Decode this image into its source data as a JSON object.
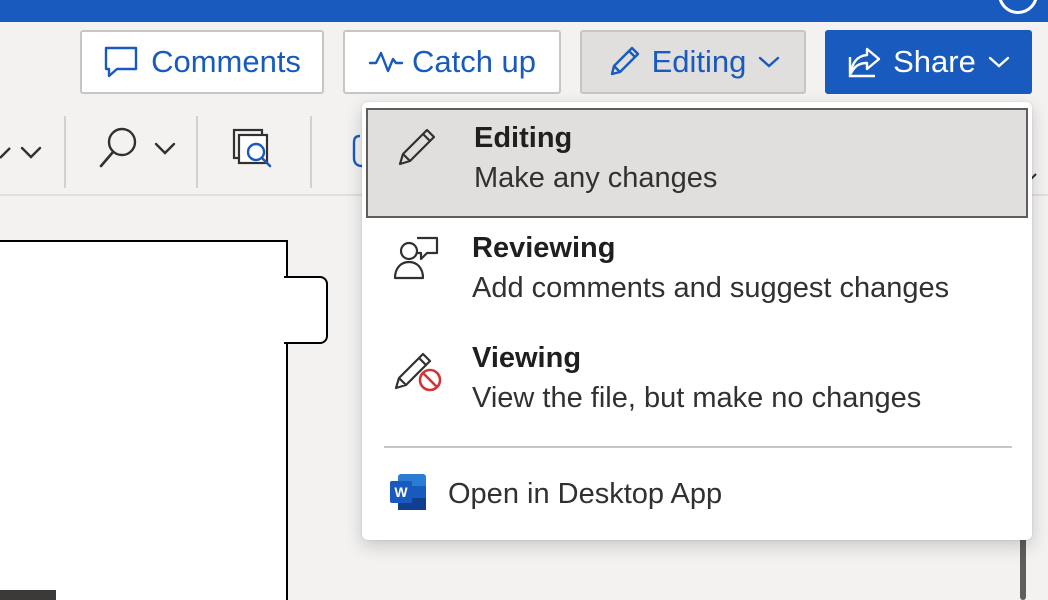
{
  "colors": {
    "brand": "#185abd",
    "selected_bg": "#e1dfdd",
    "text": "#201f1e"
  },
  "toolbar": {
    "comments_label": "Comments",
    "catchup_label": "Catch up",
    "editing_label": "Editing",
    "share_label": "Share"
  },
  "ribbon": {
    "icons": [
      "highlighter-dropdown-icon",
      "find-icon",
      "editor-search-icon",
      "dictate-icon"
    ]
  },
  "mode_menu": {
    "items": [
      {
        "id": "editing",
        "title": "Editing",
        "description": "Make any changes",
        "icon": "pencil-icon",
        "selected": true
      },
      {
        "id": "reviewing",
        "title": "Reviewing",
        "description": "Add comments and suggest changes",
        "icon": "reviewer-icon",
        "selected": false
      },
      {
        "id": "viewing",
        "title": "Viewing",
        "description": "View the file, but make no changes",
        "icon": "pencil-no-edit-icon",
        "selected": false
      }
    ],
    "open_desktop_label": "Open in Desktop App",
    "open_desktop_icon": "word-app-icon"
  }
}
